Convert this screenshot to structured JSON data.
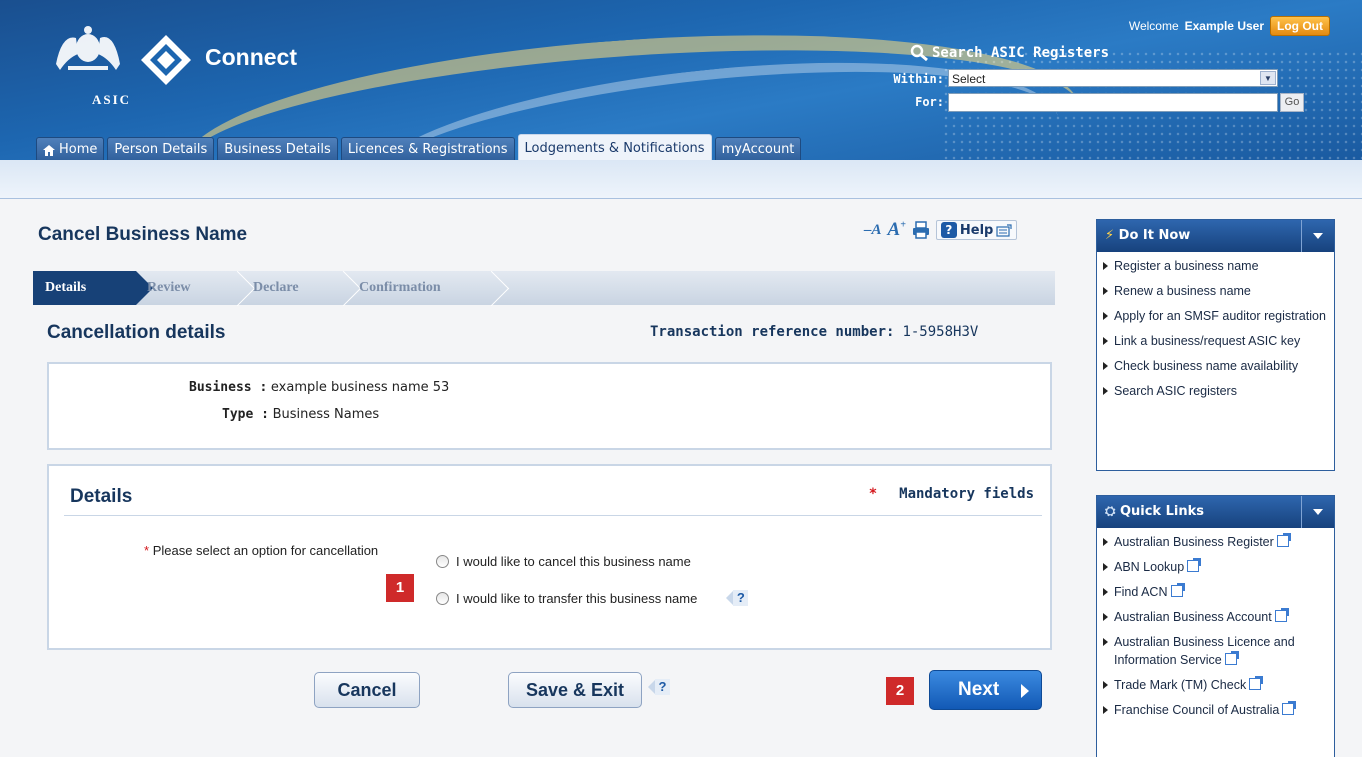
{
  "header": {
    "brand": "Connect",
    "agency": "ASIC",
    "welcome_prefix": "Welcome",
    "user_name": "Example User",
    "logout_label": "Log Out",
    "search_title": "Search ASIC Registers",
    "within_label": "Within:",
    "within_value": "Select",
    "for_label": "For:",
    "for_value": "",
    "go_label": "Go"
  },
  "tabs": [
    {
      "label": "Home",
      "icon": "home-icon"
    },
    {
      "label": "Person Details"
    },
    {
      "label": "Business Details"
    },
    {
      "label": "Licences & Registrations"
    },
    {
      "label": "Lodgements & Notifications",
      "active": true
    },
    {
      "label": "myAccount"
    }
  ],
  "page": {
    "title": "Cancel Business Name",
    "help_label": "Help",
    "steps": [
      "Details",
      "Review",
      "Declare",
      "Confirmation"
    ],
    "active_step": "Details",
    "section_heading": "Cancellation details",
    "tx_ref_label": "Transaction reference number:",
    "tx_ref_value": "1-5958H3V",
    "business_label": "Business :",
    "business_value": "example business name 53",
    "type_label": "Type :",
    "type_value": "Business Names"
  },
  "details": {
    "title": "Details",
    "mandatory_star": "*",
    "mandatory_label": "Mandatory fields",
    "question_star": "*",
    "question": "Please select an option for cancellation",
    "options": [
      "I would like to cancel this business name",
      "I would like to transfer this business name"
    ],
    "help_glyph": "?"
  },
  "annotations": {
    "badge1": "1",
    "badge2": "2"
  },
  "buttons": {
    "cancel": "Cancel",
    "save_exit": "Save & Exit",
    "next": "Next"
  },
  "sidebar": {
    "do_it_now": {
      "title": "Do It Now",
      "items": [
        "Register a business name",
        "Renew a business name",
        "Apply for an SMSF auditor registration",
        "Link a business/request ASIC key",
        "Check business name availability",
        "Search ASIC registers"
      ]
    },
    "quick_links": {
      "title": "Quick Links",
      "items": [
        "Australian Business Register",
        "ABN Lookup",
        "Find ACN",
        "Australian Business Account",
        "Australian Business Licence and Information Service",
        "Trade Mark (TM) Check",
        "Franchise Council of Australia"
      ]
    }
  },
  "colors": {
    "header_blue": "#1d66b0",
    "heading_navy": "#17365d",
    "mandatory_red": "#d4171c",
    "next_blue": "#1259b5",
    "badge_red": "#cf2a2a",
    "logout_orange": "#e48a10"
  }
}
